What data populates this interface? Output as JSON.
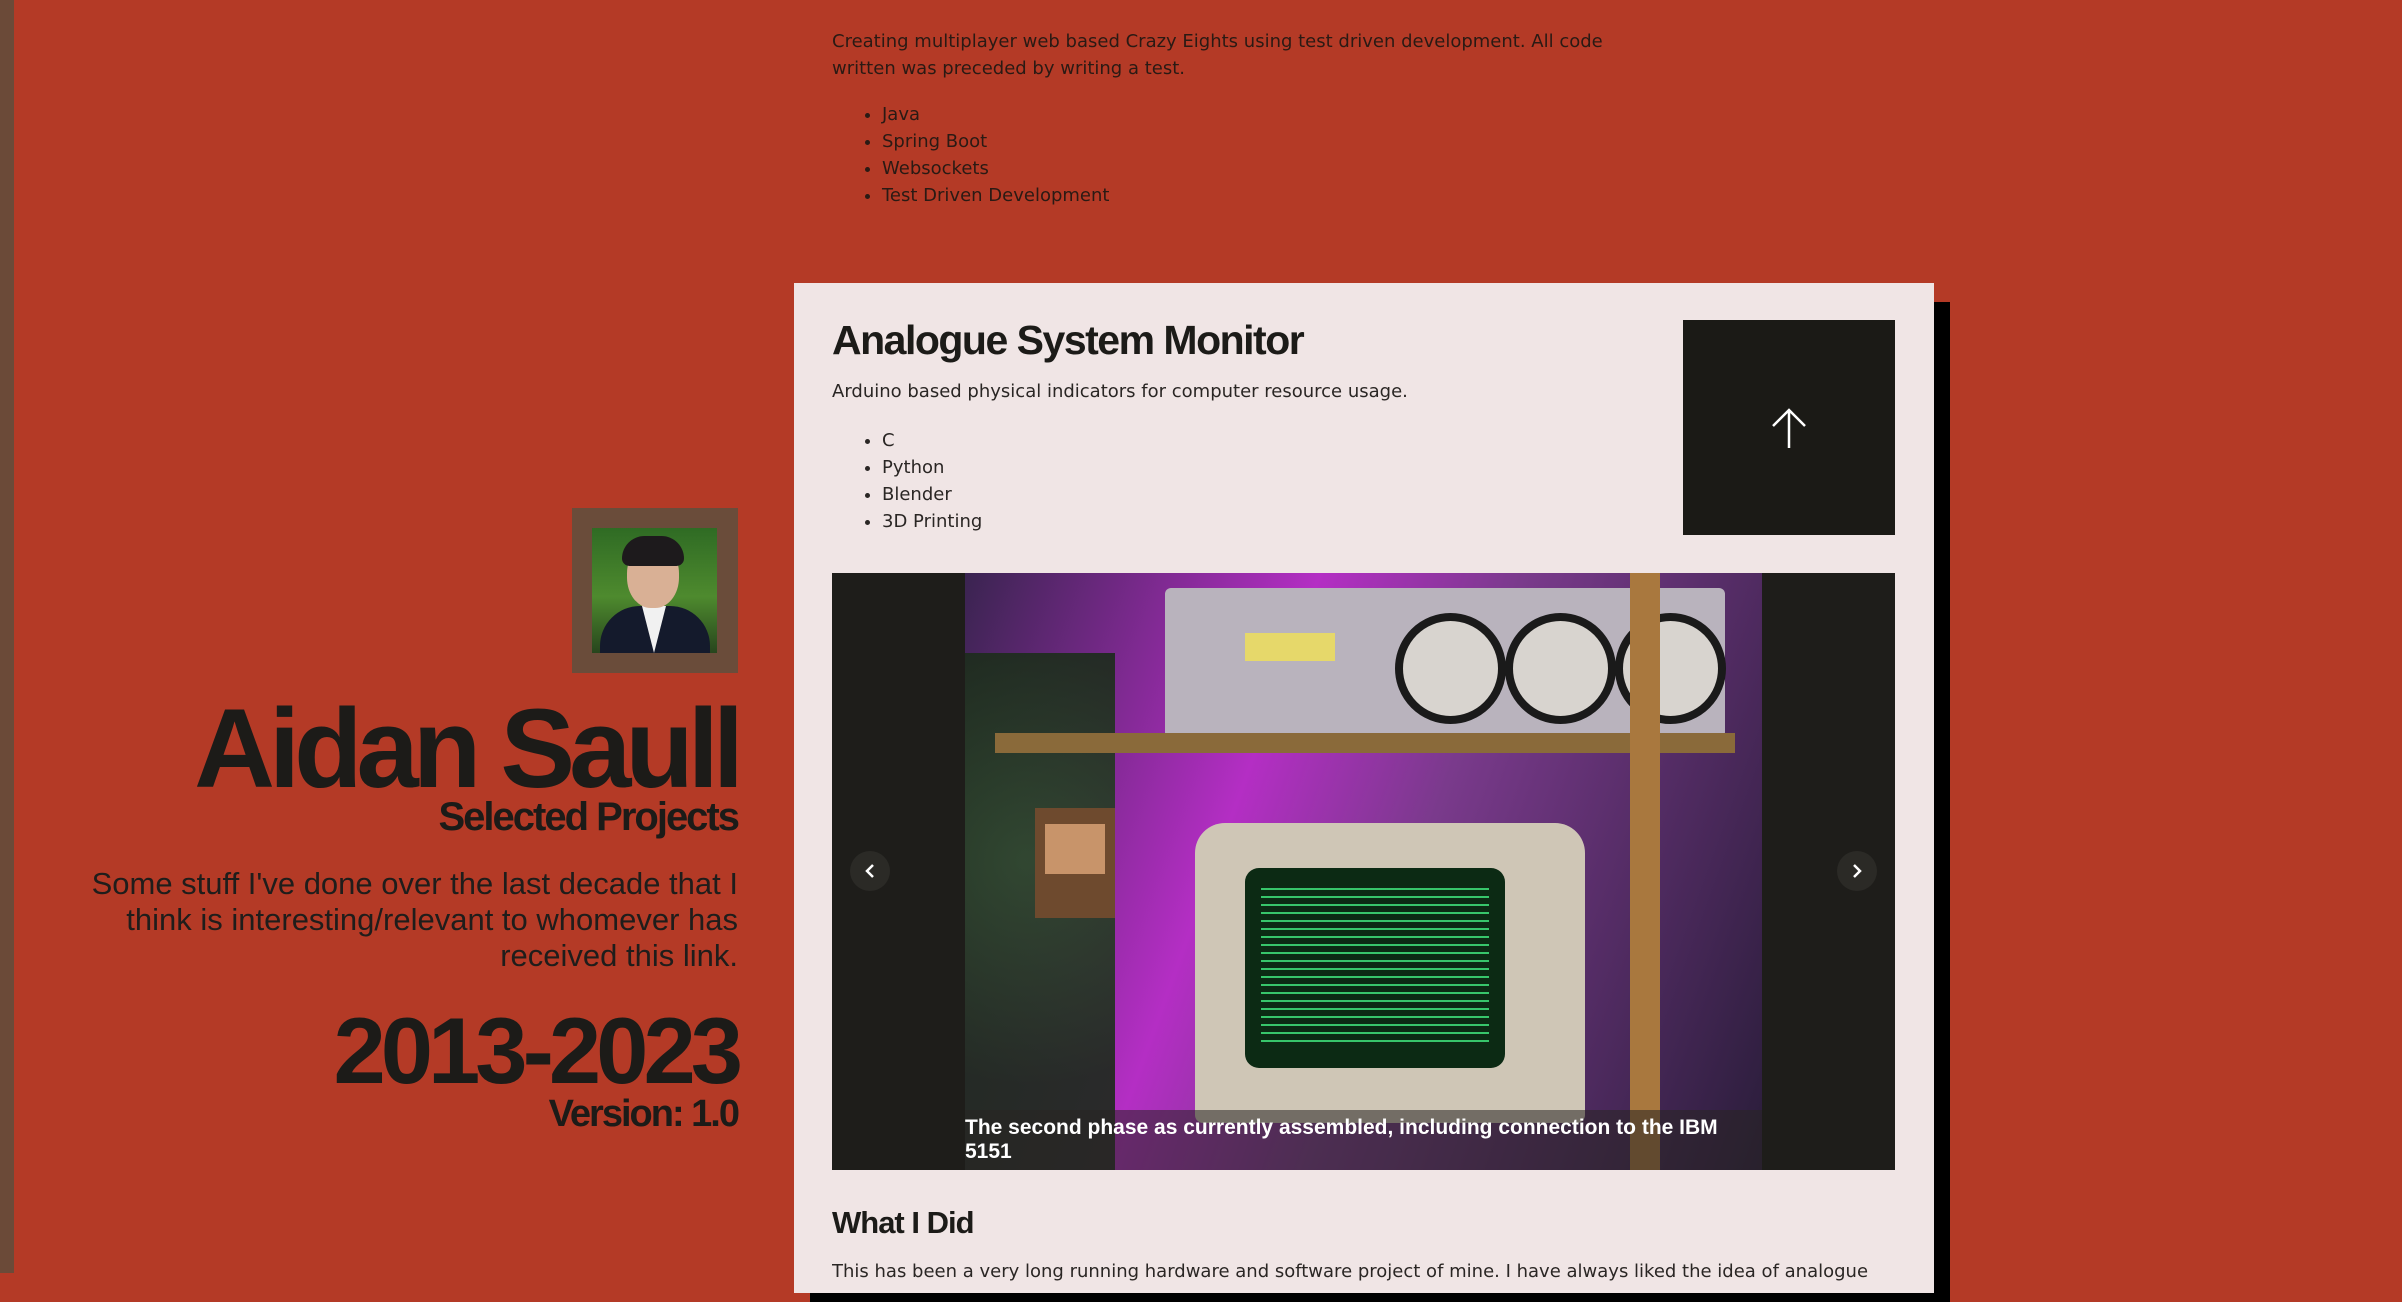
{
  "sidebar": {
    "name": "Aidan Saull",
    "subtitle": "Selected Projects",
    "tagline": "Some stuff I've done over the last decade that I think is interesting/relevant to whomever has received this link.",
    "years": "2013-2023",
    "version": "Version: 1.0"
  },
  "previous_project": {
    "description": "Creating multiplayer web based Crazy Eights using test driven development. All code written was preceded by writing a test.",
    "tech": [
      "Java",
      "Spring Boot",
      "Websockets",
      "Test Driven Development"
    ]
  },
  "project": {
    "title": "Analogue System Monitor",
    "description": "Arduino based physical indicators for computer resource usage.",
    "tech": [
      "C",
      "Python",
      "Blender",
      "3D Printing"
    ],
    "up_button_icon": "arrow-up-icon",
    "carousel": {
      "caption": "The second phase as currently assembled, including connection to the IBM 5151",
      "prev_icon": "chevron-left-icon",
      "next_icon": "chevron-right-icon"
    },
    "section_heading": "What I Did",
    "body_text": "This has been a very long running hardware and software project of mine. I have always liked the idea of analogue"
  },
  "colors": {
    "background": "#b43a26",
    "card": "#f0e5e5",
    "dark": "#1b1a16"
  }
}
